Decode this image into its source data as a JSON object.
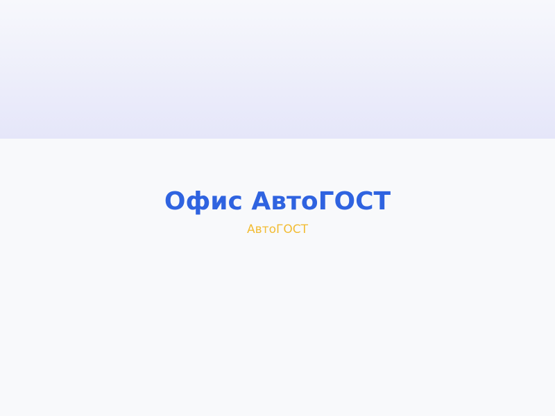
{
  "page": {
    "title": "Офис АвтоГОСТ",
    "subtitle": "АвтоГОСТ"
  },
  "colors": {
    "title": "#2f63e0",
    "subtitle": "#f2bc33",
    "background": "#f8f9fb",
    "header_band_top": "#f7f8fc",
    "header_band_bottom": "#e5e6f9"
  }
}
